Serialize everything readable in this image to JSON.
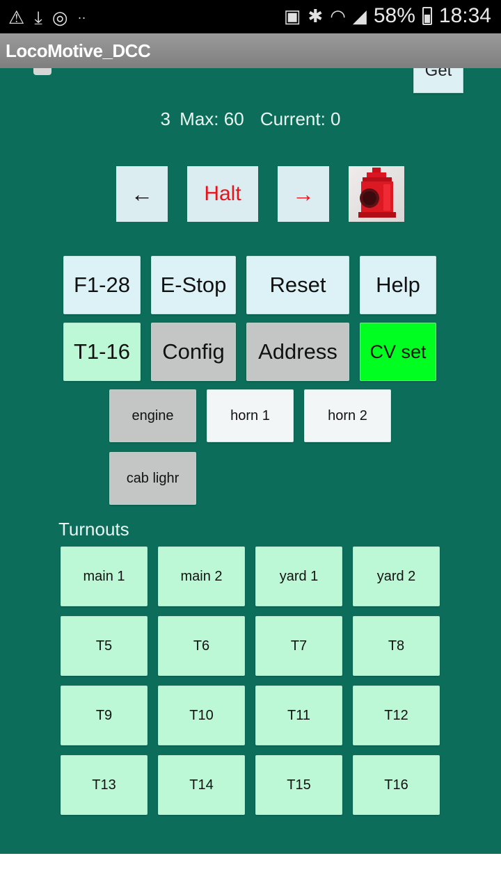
{
  "status_bar": {
    "left_icons": [
      "warning-icon",
      "download-icon",
      "sync-icon",
      "more-dots-icon"
    ],
    "right_icons": [
      "cast-icon",
      "bluetooth-icon",
      "wifi-icon",
      "signal-icon"
    ],
    "battery": "58%",
    "time": "18:34"
  },
  "app": {
    "title": "LocoMotive_DCC"
  },
  "throttle": {
    "slider_value": 0,
    "get_label": "Get",
    "speed_min_fragment": "3",
    "max_label": "Max: 60",
    "current_label": "Current: 0"
  },
  "direction": {
    "reverse_label": "←",
    "halt_label": "Halt",
    "forward_label": "→",
    "lamp_image": "red-lantern-image"
  },
  "controls": {
    "row1": [
      "F1-28",
      "E-Stop",
      "Reset",
      "Help"
    ],
    "row2": [
      "T1-16",
      "Config",
      "Address",
      "CV set"
    ]
  },
  "functions": [
    "engine",
    "horn 1",
    "horn 2",
    "cab lighr"
  ],
  "turnouts": {
    "label": "Turnouts",
    "items": [
      "main 1",
      "main 2",
      "yard 1",
      "yard 2",
      "T5",
      "T6",
      "T7",
      "T8",
      "T9",
      "T10",
      "T11",
      "T12",
      "T13",
      "T14",
      "T15",
      "T16"
    ]
  },
  "colors": {
    "background": "#0c6e5a",
    "active_green": "#00ff20",
    "turnout_mint": "#bcf7d6",
    "halt_red": "#e8141c"
  }
}
